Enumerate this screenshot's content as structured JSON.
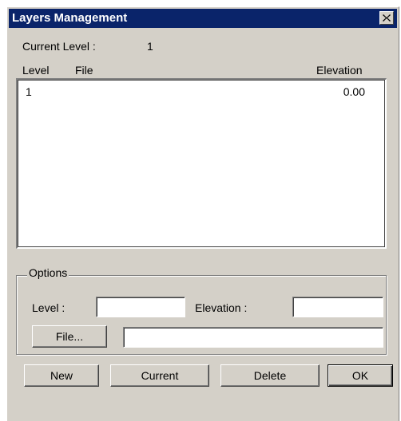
{
  "window": {
    "title": "Layers Management"
  },
  "current_level": {
    "label": "Current Level :",
    "value": "1"
  },
  "list": {
    "headers": {
      "level": "Level",
      "file": "File",
      "elevation": "Elevation"
    },
    "rows": [
      {
        "level": "1",
        "file": "",
        "elevation": "0.00"
      }
    ]
  },
  "options": {
    "legend": "Options",
    "level_label": "Level :",
    "level_value": "",
    "elevation_label": "Elevation :",
    "elevation_value": "",
    "file_button": "File...",
    "file_value": ""
  },
  "buttons": {
    "new": "New",
    "current": "Current",
    "delete": "Delete",
    "ok": "OK"
  },
  "icons": {
    "close": "close-icon"
  }
}
